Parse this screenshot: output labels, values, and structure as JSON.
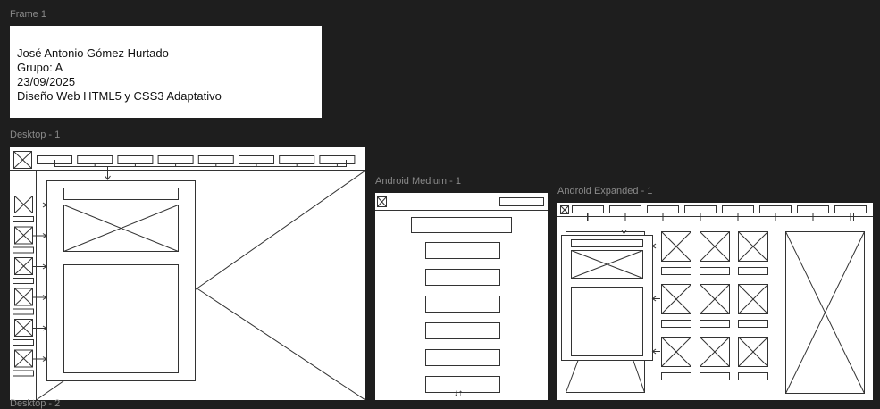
{
  "canvas": {
    "background": "#1e1e1e",
    "frame_label_color": "#8a8a8a",
    "wire_color": "#333333"
  },
  "frames": {
    "frame1": {
      "label": "Frame 1",
      "lines": [
        "José Antonio Gómez Hurtado",
        "Grupo: A",
        "23/09/2025",
        "Diseño Web HTML5 y CSS3 Adaptativo"
      ]
    },
    "desktop1": {
      "label": "Desktop - 1",
      "nav_item_count": 8,
      "side_item_count": 6
    },
    "android_medium": {
      "label": "Android Medium - 1",
      "scroll_arrows": "↓↑",
      "button_count": 6
    },
    "android_expanded": {
      "label": "Android Expanded - 1",
      "nav_item_count": 8,
      "grid_rows": 3,
      "grid_cols": 3
    },
    "desktop2": {
      "label": "Desktop - 2"
    }
  }
}
